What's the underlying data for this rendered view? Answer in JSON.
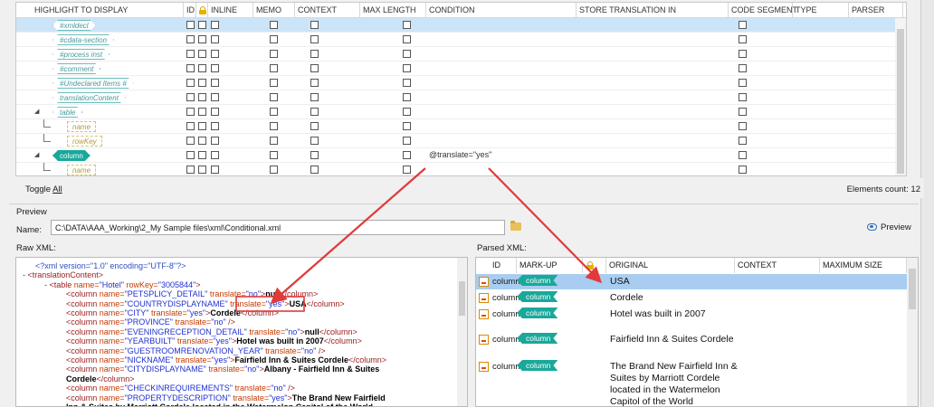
{
  "grid": {
    "columns": [
      "HIGHLIGHT TO DISPLAY",
      "ID",
      "",
      "INLINE",
      "MEMO",
      "CONTEXT",
      "MAX LENGTH",
      "CONDITION",
      "STORE TRANSLATION IN",
      "CODE SEGMENT",
      "TYPE",
      "PARSER"
    ],
    "rows": [
      {
        "tag": "#xmldecl",
        "kind": "node",
        "selected": true
      },
      {
        "tag": "#cdata-section",
        "kind": "node"
      },
      {
        "tag": "#process inst",
        "kind": "node"
      },
      {
        "tag": "#comment",
        "kind": "node"
      },
      {
        "tag": "#Undeclared Items #",
        "kind": "node"
      },
      {
        "tag": "translationContent",
        "kind": "node"
      },
      {
        "tag": "table",
        "kind": "node",
        "expander": "▲"
      },
      {
        "tag": "name",
        "kind": "attr"
      },
      {
        "tag": "rowKey",
        "kind": "attr"
      },
      {
        "tag": "column",
        "kind": "node-filled",
        "expander": "▲",
        "condition": "@translate=\"yes\""
      },
      {
        "tag": "name",
        "kind": "attr"
      }
    ],
    "toggle_all": "Toggle All",
    "toggle_all_prefix": "Toggle ",
    "toggle_all_underlined": "All",
    "elements_count": "Elements count: 12"
  },
  "preview": {
    "section_label": "Preview",
    "name_label": "Name:",
    "name_value": "C:\\DATA\\AAA_Working\\2_My Sample files\\xml\\Conditional.xml",
    "preview_button": "Preview",
    "raw_label": "Raw XML:",
    "parsed_label": "Parsed XML:"
  },
  "raw_xml": {
    "line1": "<?xml version=\"1.0\" encoding=\"UTF-8\"?>",
    "line2": "- <translationContent>",
    "line3_pre": "- <table ",
    "line3_a1": "name=",
    "line3_v1": "\"Hotel\"",
    "line3_a2": " rowKey=",
    "line3_v2": "\"3005844\"",
    "line3_post": ">",
    "cols": [
      {
        "name": "\"PETSPLICY_DETAIL\"",
        "tr": "\"no\"",
        "text": "null"
      },
      {
        "name": "\"COUNTRYDISPLAYNAME\"",
        "tr": "\"yes\"",
        "text": "USA"
      },
      {
        "name": "\"CITY\"",
        "tr": "\"yes\"",
        "text": "Cordele"
      },
      {
        "name": "\"PROVINCE\"",
        "tr": "\"no\"",
        "text": ""
      },
      {
        "name": "\"EVENINGRECEPTION_DETAIL\"",
        "tr": "\"no\"",
        "text": "null"
      },
      {
        "name": "\"YEARBUILT\"",
        "tr": "\"yes\"",
        "text": "Hotel was built in 2007"
      },
      {
        "name": "\"GUESTROOMRENOVATION_YEAR\"",
        "tr": "\"no\"",
        "text": ""
      },
      {
        "name": "\"NICKNAME\"",
        "tr": "\"yes\"",
        "text": "Fairfield Inn & Suites Cordele"
      },
      {
        "name": "\"CITYDISPLAYNAME\"",
        "tr": "\"no\"",
        "text": "Albany - Fairfield Inn & Suites"
      },
      {
        "name": "\"CHECKINREQUIREMENTS\"",
        "tr": "\"no\"",
        "text": ""
      },
      {
        "name": "\"PROPERTYDESCRIPTION\"",
        "tr": "\"yes\"",
        "text": "The Brand New Fairfield"
      }
    ],
    "wrap1": "Cordele",
    "wrap2": "Inn & Suites by Marriott Cordele located in the Watermelon Capitol of the World",
    "col_open": "<column ",
    "attr_name": "name=",
    "attr_translate": " translate=",
    "close_tag": "</column>",
    "self_close": " />"
  },
  "parsed": {
    "columns": [
      "ID",
      "MARK-UP",
      "",
      "ORIGINAL",
      "CONTEXT",
      "MAXIMUM SIZE"
    ],
    "rows": [
      {
        "id": "column",
        "tag": "column",
        "original": "USA",
        "selected": true
      },
      {
        "id": "column",
        "tag": "column",
        "original": "Cordele"
      },
      {
        "id": "column",
        "tag": "column",
        "original": "Hotel was built in 2007"
      },
      {
        "id": "column",
        "tag": "column",
        "original": "Fairfield Inn & Suites Cordele"
      },
      {
        "id": "column",
        "tag": "column",
        "original": "The Brand New Fairfield Inn & Suites by Marriott Cordele located in the Watermelon Capitol of the World"
      }
    ]
  },
  "colors": {
    "accent_teal": "#1aa89a",
    "selection": "#cce4f7",
    "arrow_red": "#e03a3a"
  }
}
